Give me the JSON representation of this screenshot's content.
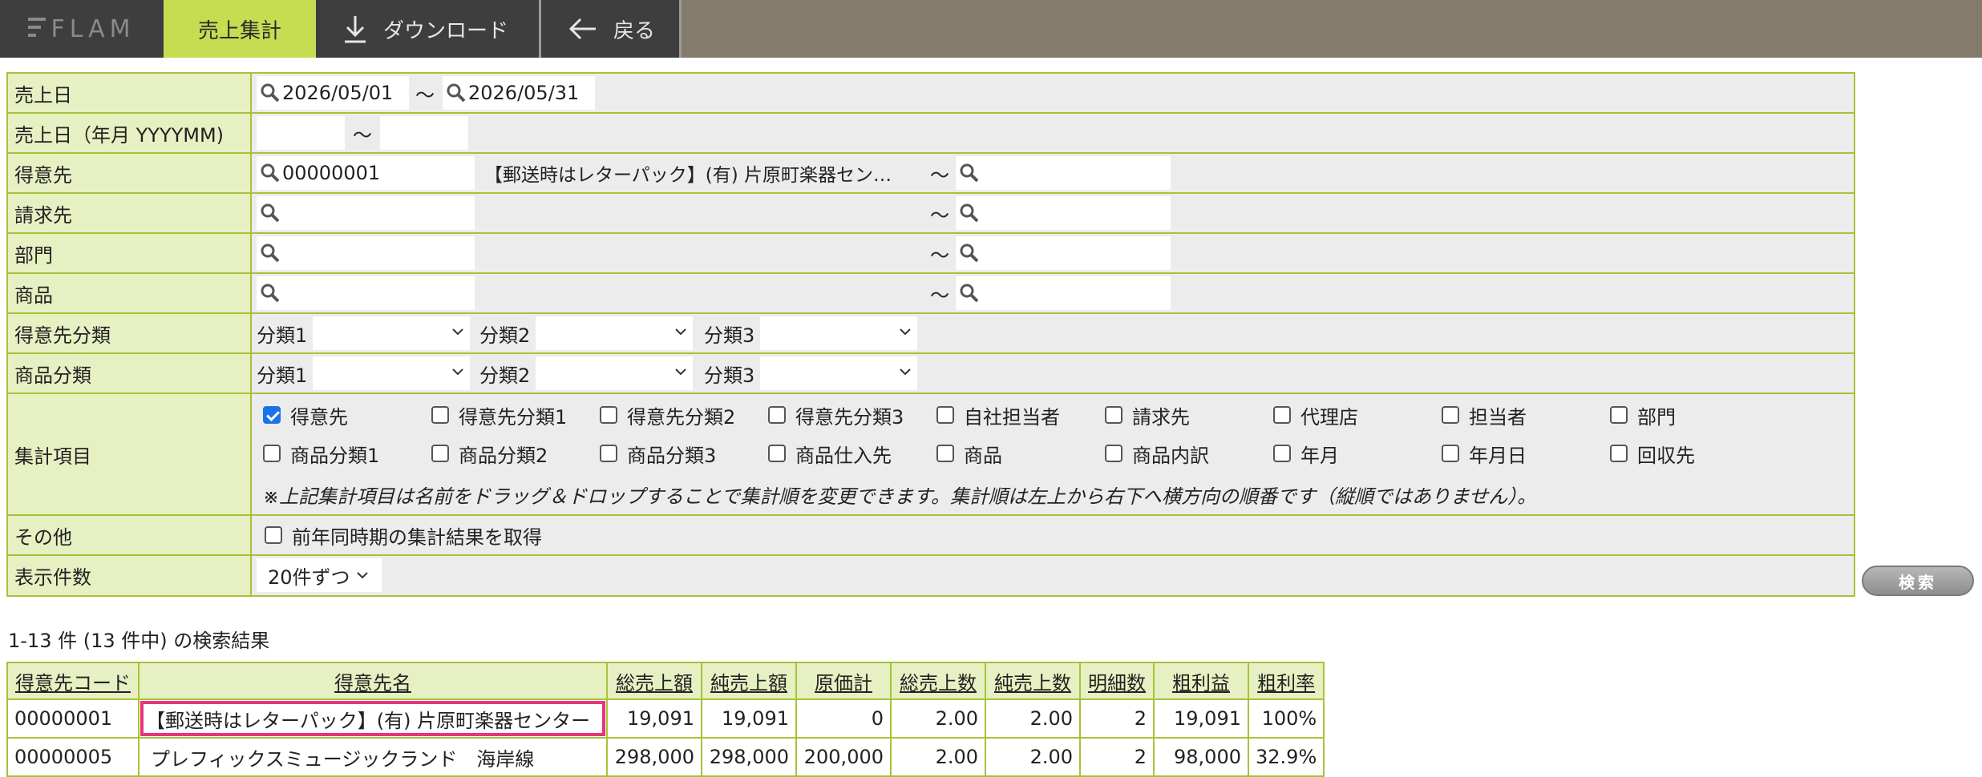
{
  "app": {
    "logo": "FLAM"
  },
  "nav": {
    "active_tab": "売上集計",
    "download": "ダウンロード",
    "back": "戻る"
  },
  "form": {
    "sales_date": {
      "label": "売上日",
      "from": "2026/05/01",
      "tilde": "〜",
      "to": "2026/05/31"
    },
    "sales_month": {
      "label": "売上日（年月 YYYYMM)",
      "from": "",
      "tilde": "〜",
      "to": ""
    },
    "customer": {
      "label": "得意先",
      "from_code": "00000001",
      "from_name": "【郵送時はレターパック】(有) 片原町楽器セン…",
      "tilde": "〜",
      "to_code": ""
    },
    "billing": {
      "label": "請求先",
      "tilde": "〜"
    },
    "department": {
      "label": "部門",
      "tilde": "〜"
    },
    "product": {
      "label": "商品",
      "tilde": "〜"
    },
    "customer_class": {
      "label": "得意先分類",
      "c1": "分類1",
      "c2": "分類2",
      "c3": "分類3"
    },
    "product_class": {
      "label": "商品分類",
      "c1": "分類1",
      "c2": "分類2",
      "c3": "分類3"
    },
    "aggregate": {
      "label": "集計項目",
      "items": [
        {
          "label": "得意先",
          "checked": true
        },
        {
          "label": "得意先分類1",
          "checked": false
        },
        {
          "label": "得意先分類2",
          "checked": false
        },
        {
          "label": "得意先分類3",
          "checked": false
        },
        {
          "label": "自社担当者",
          "checked": false
        },
        {
          "label": "請求先",
          "checked": false
        },
        {
          "label": "代理店",
          "checked": false
        },
        {
          "label": "担当者",
          "checked": false
        },
        {
          "label": "部門",
          "checked": false
        },
        {
          "label": "商品分類1",
          "checked": false
        },
        {
          "label": "商品分類2",
          "checked": false
        },
        {
          "label": "商品分類3",
          "checked": false
        },
        {
          "label": "商品仕入先",
          "checked": false
        },
        {
          "label": "商品",
          "checked": false
        },
        {
          "label": "商品内訳",
          "checked": false
        },
        {
          "label": "年月",
          "checked": false
        },
        {
          "label": "年月日",
          "checked": false
        },
        {
          "label": "回収先",
          "checked": false
        }
      ],
      "note": "※上記集計項目は名前をドラッグ＆ドロップすることで集計順を変更できます。集計順は左上から右下へ横方向の順番です（縦順ではありません）。"
    },
    "other": {
      "label": "その他",
      "option": "前年同時期の集計結果を取得"
    },
    "per_page": {
      "label": "表示件数",
      "value": "20件ずつ"
    }
  },
  "search_button": "検索",
  "result_count": "1-13 件 (13 件中) の検索結果",
  "table": {
    "headers": [
      "得意先コード",
      "得意先名",
      "総売上額",
      "純売上額",
      "原価計",
      "総売上数",
      "純売上数",
      "明細数",
      "粗利益",
      "粗利率"
    ],
    "rows": [
      [
        "00000001",
        "【郵送時はレターパック】(有) 片原町楽器センター",
        "19,091",
        "19,091",
        "0",
        "2.00",
        "2.00",
        "2",
        "19,091",
        "100%"
      ],
      [
        "00000005",
        "プレフィックスミュージックランド　海岸線",
        "298,000",
        "298,000",
        "200,000",
        "2.00",
        "2.00",
        "2",
        "98,000",
        "32.9%"
      ]
    ]
  },
  "colors": {
    "accent": "#c6dd52",
    "border": "#a8c238",
    "label_bg": "#e6f0c2",
    "highlight": "#e8347a",
    "topbar": "#857b6b"
  }
}
